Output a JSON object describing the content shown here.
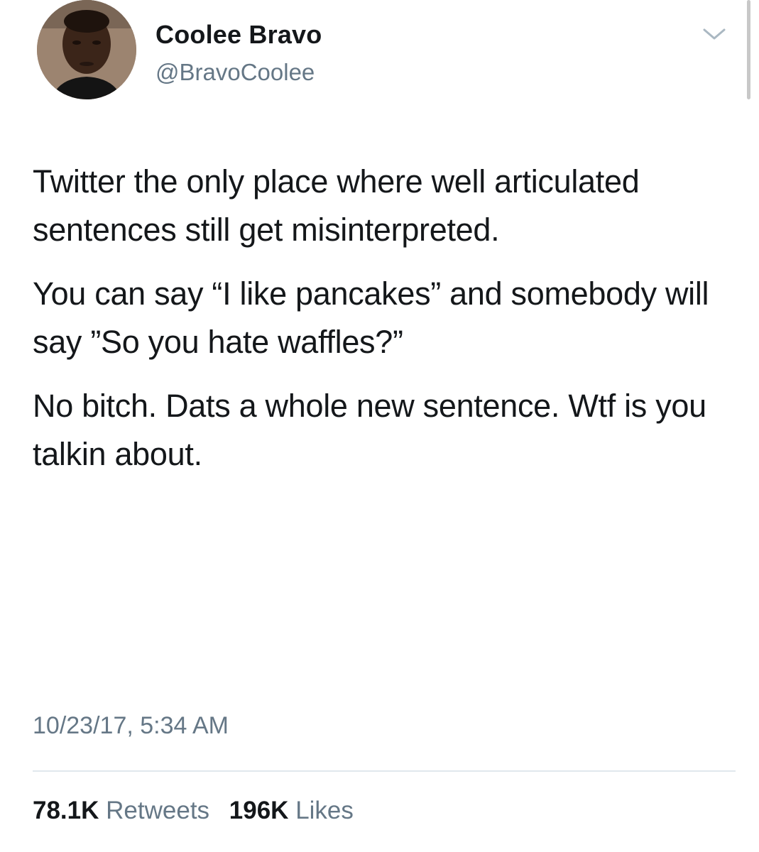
{
  "author": {
    "display_name": "Coolee Bravo",
    "handle": "@BravoCoolee"
  },
  "tweet": {
    "paragraphs": [
      "Twitter the only place where well articulated sentences still get misinterpreted.",
      "You can say “I like pancakes” and somebody will say ”So you hate waffles?”",
      "No bitch. Dats a whole new sentence. Wtf is you talkin about."
    ],
    "timestamp": "10/23/17, 5:34 AM"
  },
  "stats": {
    "retweets_count": "78.1K",
    "retweets_label": "Retweets",
    "likes_count": "196K",
    "likes_label": "Likes"
  },
  "icons": {
    "menu": "chevron-down-icon"
  },
  "colors": {
    "primary_text": "#14171a",
    "secondary_text": "#657786",
    "divider": "#e1e8ed"
  }
}
